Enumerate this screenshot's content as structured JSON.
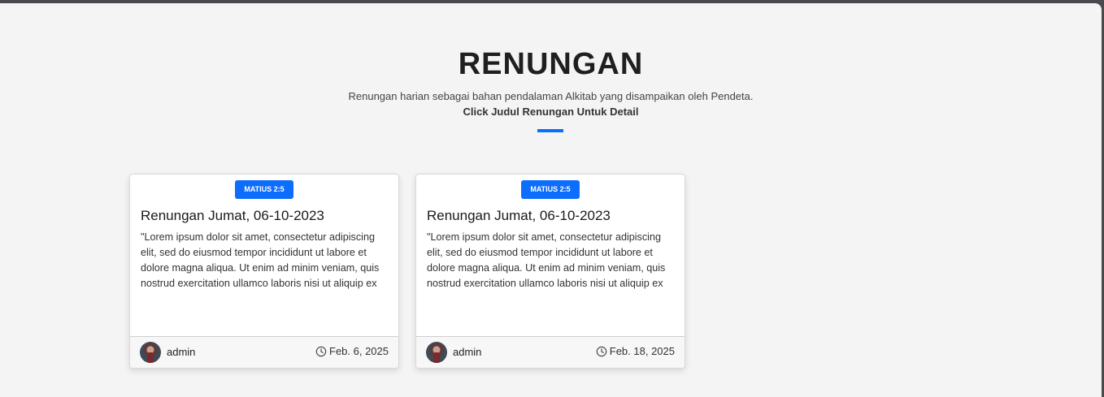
{
  "section": {
    "title": "RENUNGAN",
    "subtitle": "Renungan harian sebagai bahan pendalaman Alkitab yang disampaikan oleh Pendeta.",
    "hint": "Click Judul Renungan Untuk Detail"
  },
  "colors": {
    "accent": "#0d6efd",
    "background": "#f4f4f4"
  },
  "cards": [
    {
      "badge": "MATIUS 2:5",
      "title": "Renungan Jumat, 06-10-2023",
      "excerpt": "\"Lorem ipsum dolor sit amet, consectetur adipiscing elit, sed do eiusmod tempor incididunt ut labore et dolore magna aliqua. Ut enim ad minim veniam, quis nostrud exercitation ullamco laboris nisi ut aliquip ex",
      "author": "admin",
      "date": "Feb. 6, 2025",
      "author_icon": "avatar",
      "date_icon": "clock-icon"
    },
    {
      "badge": "MATIUS 2:5",
      "title": "Renungan Jumat, 06-10-2023",
      "excerpt": "\"Lorem ipsum dolor sit amet, consectetur adipiscing elit, sed do eiusmod tempor incididunt ut labore et dolore magna aliqua. Ut enim ad minim veniam, quis nostrud exercitation ullamco laboris nisi ut aliquip ex",
      "author": "admin",
      "date": "Feb. 18, 2025",
      "author_icon": "avatar",
      "date_icon": "clock-icon"
    }
  ]
}
